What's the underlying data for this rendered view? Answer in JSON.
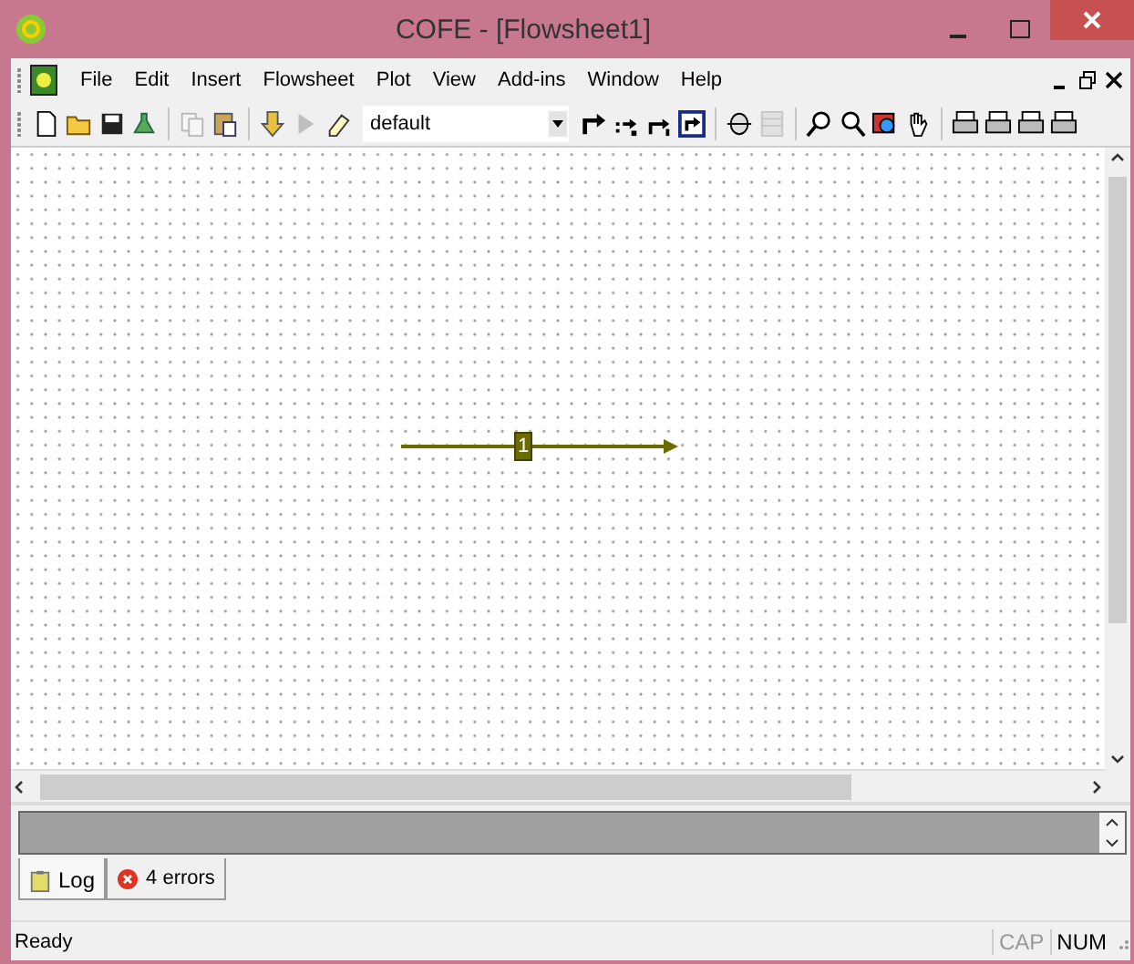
{
  "window": {
    "title": "COFE - [Flowsheet1]"
  },
  "menu": [
    "File",
    "Edit",
    "Insert",
    "Flowsheet",
    "Plot",
    "View",
    "Add-ins",
    "Window",
    "Help"
  ],
  "toolbar": [
    {
      "kind": "new",
      "disabled": false
    },
    {
      "kind": "open",
      "disabled": false
    },
    {
      "kind": "save",
      "disabled": false
    },
    {
      "kind": "flask",
      "disabled": false
    },
    {
      "kind": "copy",
      "disabled": true
    },
    {
      "kind": "paste",
      "disabled": false
    },
    {
      "kind": "download",
      "disabled": false
    },
    {
      "kind": "play",
      "disabled": true
    },
    {
      "kind": "eraser",
      "disabled": false
    },
    {
      "kind": "stream",
      "disabled": false
    },
    {
      "kind": "stream-e",
      "disabled": false
    },
    {
      "kind": "stream-i",
      "disabled": false
    },
    {
      "kind": "stream-box",
      "disabled": false
    },
    {
      "kind": "unit",
      "disabled": false
    },
    {
      "kind": "table",
      "disabled": true
    },
    {
      "kind": "zoom-in",
      "disabled": false
    },
    {
      "kind": "zoom-out",
      "disabled": false
    },
    {
      "kind": "zoom-fit",
      "disabled": false
    },
    {
      "kind": "hand",
      "disabled": false
    },
    {
      "kind": "print",
      "disabled": false
    },
    {
      "kind": "print",
      "disabled": false
    },
    {
      "kind": "print",
      "disabled": false
    },
    {
      "kind": "print",
      "disabled": false
    }
  ],
  "model_combo": {
    "value": "default"
  },
  "flowsheet": {
    "stream_label": "1"
  },
  "log_tabs": [
    {
      "label": "Log",
      "kind": "log",
      "selected": true
    },
    {
      "label": "4 errors",
      "kind": "errors",
      "selected": false
    }
  ],
  "status_bar": {
    "text": "Ready",
    "indicators": [
      {
        "label": "CAP",
        "on": false
      },
      {
        "label": "NUM",
        "on": true
      }
    ]
  }
}
